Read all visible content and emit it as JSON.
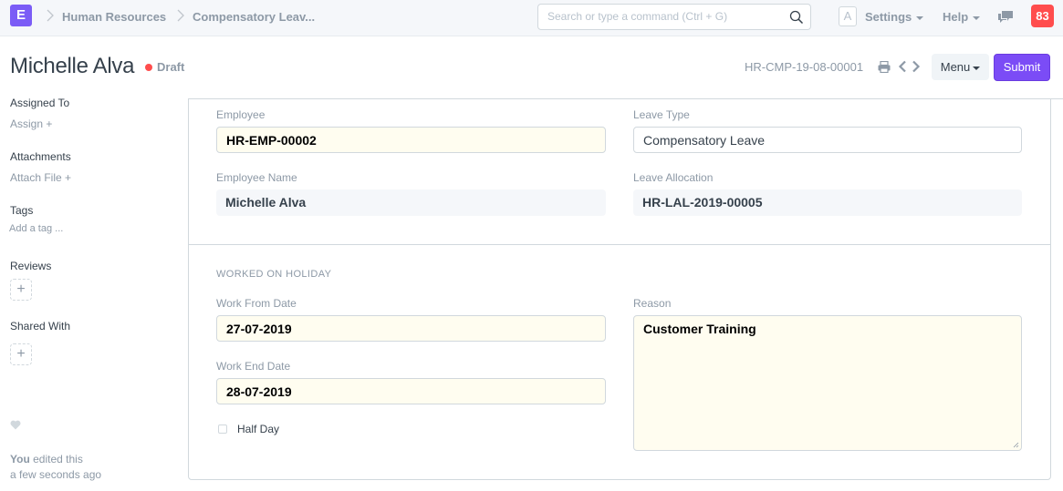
{
  "navbar": {
    "logo_letter": "E",
    "breadcrumbs": [
      "Human Resources",
      "Compensatory Leav..."
    ],
    "search_placeholder": "Search or type a command (Ctrl + G)",
    "avatar_letter": "A",
    "settings_label": "Settings",
    "help_label": "Help",
    "notification_count": "83"
  },
  "page_head": {
    "title": "Michelle Alva",
    "status": "Draft",
    "doc_name": "HR-CMP-19-08-00001",
    "menu_label": "Menu",
    "submit_label": "Submit"
  },
  "sidebar": {
    "assigned_to_heading": "Assigned To",
    "assign_link": "Assign +",
    "attachments_heading": "Attachments",
    "attach_link": "Attach File +",
    "tags_heading": "Tags",
    "tags_placeholder": "Add a tag ...",
    "reviews_heading": "Reviews",
    "shared_heading": "Shared With",
    "add_symbol": "+",
    "activity_user": "You",
    "activity_text": " edited this",
    "activity_time": "a few seconds ago"
  },
  "form": {
    "employee_label": "Employee",
    "employee_value": "HR-EMP-00002",
    "leave_type_label": "Leave Type",
    "leave_type_value": "Compensatory Leave",
    "employee_name_label": "Employee Name",
    "employee_name_value": "Michelle Alva",
    "leave_allocation_label": "Leave Allocation",
    "leave_allocation_value": "HR-LAL-2019-00005",
    "section_title": "WORKED ON HOLIDAY",
    "work_from_label": "Work From Date",
    "work_from_value": "27-07-2019",
    "work_end_label": "Work End Date",
    "work_end_value": "28-07-2019",
    "half_day_label": "Half Day",
    "half_day_checked": false,
    "reason_label": "Reason",
    "reason_value": "Customer Training"
  },
  "colors": {
    "brand": "#7b5cf6",
    "submit": "#7b4cf6",
    "draft_indicator": "#ff4d4d",
    "notification": "#ff4d4d",
    "mandatory_field_bg": "#fffdf0"
  }
}
